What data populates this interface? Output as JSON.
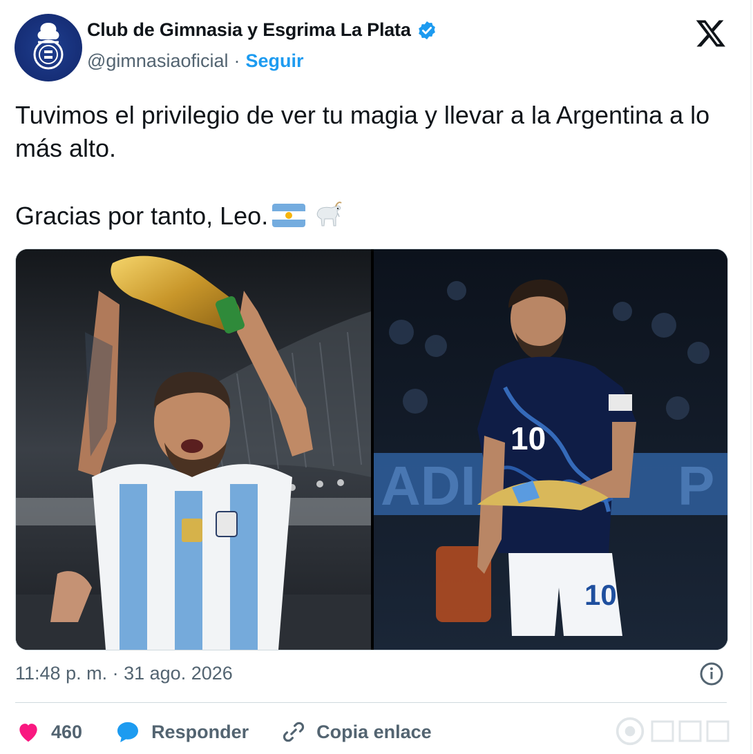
{
  "author": {
    "name": "Club de Gimnasia y Esgrima La Plata",
    "handle": "@gimnasiaoficial",
    "separator": "·",
    "follow_label": "Seguir"
  },
  "tweet": {
    "line1": "Tuvimos el privilegio de ver tu magia y llevar a la Argentina a lo más alto.",
    "line2": "Gracias por tanto, Leo."
  },
  "meta": {
    "time": "11:48 p. m.",
    "date": "31 ago. 2026",
    "separator": "·"
  },
  "actions": {
    "likes": "460",
    "reply_label": "Responder",
    "copy_label": "Copia enlace"
  },
  "colors": {
    "accent": "#1d9bf0",
    "like": "#f91880",
    "muted": "#536471"
  },
  "icons": [
    "verified-badge-icon",
    "x-logo-icon",
    "info-icon",
    "heart-icon",
    "reply-icon",
    "link-icon",
    "argentina-flag-icon",
    "goat-icon"
  ]
}
